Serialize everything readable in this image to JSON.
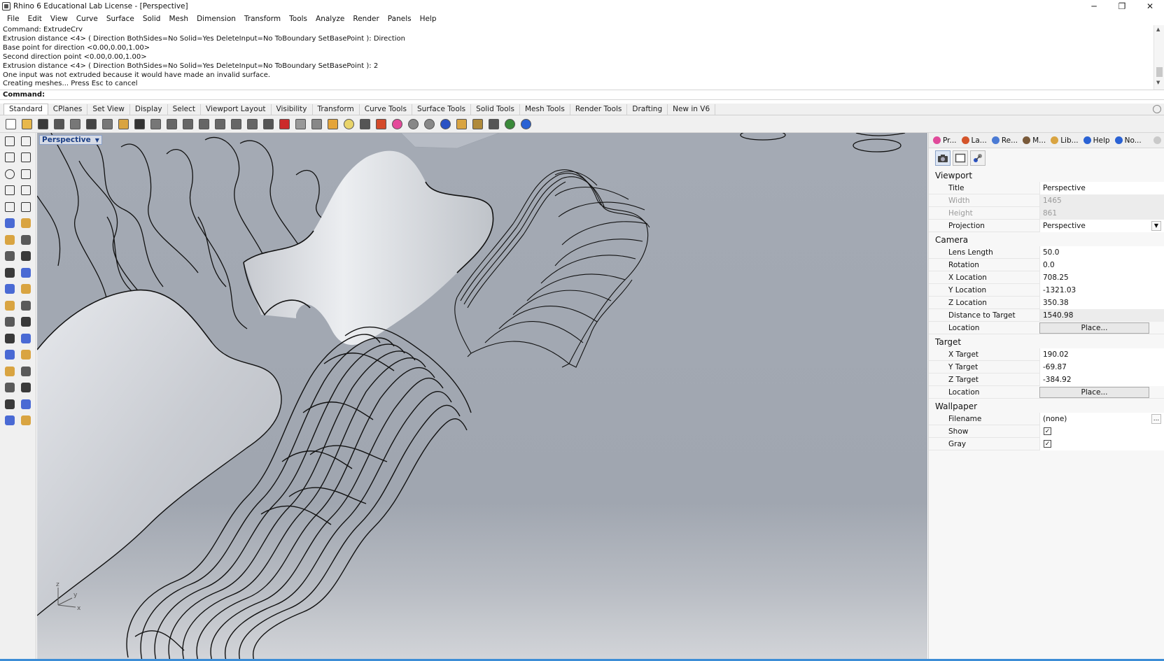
{
  "window": {
    "title": "Rhino 6 Educational Lab License - [Perspective]",
    "minimize": "─",
    "restore": "❐",
    "close": "✕"
  },
  "menu": [
    "File",
    "Edit",
    "View",
    "Curve",
    "Surface",
    "Solid",
    "Mesh",
    "Dimension",
    "Transform",
    "Tools",
    "Analyze",
    "Render",
    "Panels",
    "Help"
  ],
  "command_history": [
    "Command: ExtrudeCrv",
    "Extrusion distance <4> ( Direction  BothSides=No  Solid=Yes  DeleteInput=No  ToBoundary  SetBasePoint ): Direction",
    "Base point for direction <0.00,0.00,1.00>",
    "Second direction point <0.00,0.00,1.00>",
    "Extrusion distance <4> ( Direction  BothSides=No  Solid=Yes  DeleteInput=No  ToBoundary  SetBasePoint ): 2",
    "One input was not extruded because it would have made an invalid surface.",
    "Creating meshes... Press Esc to cancel"
  ],
  "command_prompt": {
    "label": "Command:",
    "value": ""
  },
  "toolbar_tabs": [
    "Standard",
    "CPlanes",
    "Set View",
    "Display",
    "Select",
    "Viewport Layout",
    "Visibility",
    "Transform",
    "Curve Tools",
    "Surface Tools",
    "Solid Tools",
    "Mesh Tools",
    "Render Tools",
    "Drafting",
    "New in V6"
  ],
  "active_tab": "Standard",
  "standard_tools": [
    {
      "name": "new-icon",
      "color": "#ffffff"
    },
    {
      "name": "open-icon",
      "color": "#e8b84a"
    },
    {
      "name": "save-icon",
      "color": "#3a3a3a"
    },
    {
      "name": "print-icon",
      "color": "#555555"
    },
    {
      "name": "import-icon",
      "color": "#777777"
    },
    {
      "name": "cut-icon",
      "color": "#444444"
    },
    {
      "name": "copy-icon",
      "color": "#777777"
    },
    {
      "name": "paste-icon",
      "color": "#d9a441"
    },
    {
      "name": "undo-icon",
      "color": "#333333"
    },
    {
      "name": "pan-icon",
      "color": "#777777"
    },
    {
      "name": "rotate-view-icon",
      "color": "#666666"
    },
    {
      "name": "zoom-icon",
      "color": "#666666"
    },
    {
      "name": "zoom-window-icon",
      "color": "#666666"
    },
    {
      "name": "zoom-extents-icon",
      "color": "#666666"
    },
    {
      "name": "zoom-selected-icon",
      "color": "#666666"
    },
    {
      "name": "undo-view-icon",
      "color": "#666666"
    },
    {
      "name": "four-viewports-icon",
      "color": "#555555"
    },
    {
      "name": "car-icon",
      "color": "#cc2a2a"
    },
    {
      "name": "hide-icon",
      "color": "#999999"
    },
    {
      "name": "properties-icon",
      "color": "#888888"
    },
    {
      "name": "layer-icon",
      "color": "#e4a43a"
    },
    {
      "name": "light-icon",
      "color": "#e9d46a"
    },
    {
      "name": "lock-icon",
      "color": "#555555"
    },
    {
      "name": "material-icon",
      "color": "#d44a2a"
    },
    {
      "name": "color-wheel-icon",
      "color": "#e44a9a"
    },
    {
      "name": "shaded-sphere-icon",
      "color": "#888888"
    },
    {
      "name": "rendered-sphere-icon",
      "color": "#888888"
    },
    {
      "name": "render-icon",
      "color": "#2a52c4"
    },
    {
      "name": "flag-icon",
      "color": "#d9a441"
    },
    {
      "name": "settings-icon",
      "color": "#b08a3a"
    },
    {
      "name": "dimension-icon",
      "color": "#555555"
    },
    {
      "name": "globe-icon",
      "color": "#3a8a3a"
    },
    {
      "name": "help-icon",
      "color": "#2a62d4"
    }
  ],
  "left_tools": [
    [
      "select-arrow-icon",
      "point-icon"
    ],
    [
      "polyline-icon",
      "curve-icon"
    ],
    [
      "circle-icon",
      "arc-icon"
    ],
    [
      "polygon-icon",
      "rectangle-icon"
    ],
    [
      "ellipse-icon",
      "fillet-curve-icon"
    ],
    [
      "surface-icon",
      "loft-icon"
    ],
    [
      "box-icon",
      "sphere-icon"
    ],
    [
      "cylinder-icon",
      "extrude-surface-icon"
    ],
    [
      "explode-icon",
      "join-icon"
    ],
    [
      "trim-icon",
      "split-icon"
    ],
    [
      "group-icon",
      "boolean-icon"
    ],
    [
      "offset-icon",
      "control-points-icon"
    ],
    [
      "text-icon",
      "dimension-tool-icon"
    ],
    [
      "transform-icon",
      "mirror-icon"
    ],
    [
      "mesh-icon",
      "analyze-icon"
    ],
    [
      "array-icon",
      "block-icon"
    ],
    [
      "surface-analysis-icon",
      "check-icon"
    ],
    [
      "cage-edit-icon",
      "render-tool-icon"
    ]
  ],
  "viewport": {
    "label": "Perspective",
    "axis_z": "z",
    "axis_y": "y",
    "axis_x": "x"
  },
  "panel": {
    "tabs": [
      {
        "label": "Pr...",
        "icon": "properties-icon",
        "color": "#e04a9a"
      },
      {
        "label": "La...",
        "icon": "layers-icon",
        "color": "#d4542a"
      },
      {
        "label": "Re...",
        "icon": "render-icon",
        "color": "#4a7ad4"
      },
      {
        "label": "M...",
        "icon": "materials-icon",
        "color": "#7a5a3a"
      },
      {
        "label": "Lib...",
        "icon": "library-icon",
        "color": "#d9a441"
      },
      {
        "label": "Help",
        "icon": "help-icon",
        "color": "#2a62d4"
      },
      {
        "label": "No...",
        "icon": "notifications-icon",
        "color": "#2a62d4"
      }
    ],
    "viewport": {
      "heading": "Viewport",
      "title_label": "Title",
      "title_value": "Perspective",
      "width_label": "Width",
      "width_value": "1465",
      "height_label": "Height",
      "height_value": "861",
      "projection_label": "Projection",
      "projection_value": "Perspective"
    },
    "camera": {
      "heading": "Camera",
      "lens_label": "Lens Length",
      "lens_value": "50.0",
      "rotation_label": "Rotation",
      "rotation_value": "0.0",
      "x_label": "X Location",
      "x_value": "708.25",
      "y_label": "Y Location",
      "y_value": "-1321.03",
      "z_label": "Z Location",
      "z_value": "350.38",
      "dist_label": "Distance to Target",
      "dist_value": "1540.98",
      "location_label": "Location",
      "location_button": "Place..."
    },
    "target": {
      "heading": "Target",
      "x_label": "X Target",
      "x_value": "190.02",
      "y_label": "Y Target",
      "y_value": "-69.87",
      "z_label": "Z Target",
      "z_value": "-384.92",
      "location_label": "Location",
      "location_button": "Place..."
    },
    "wallpaper": {
      "heading": "Wallpaper",
      "filename_label": "Filename",
      "filename_value": "(none)",
      "browse_button": "...",
      "show_label": "Show",
      "show_checked": true,
      "gray_label": "Gray",
      "gray_checked": true,
      "check_mark": "✓"
    }
  }
}
